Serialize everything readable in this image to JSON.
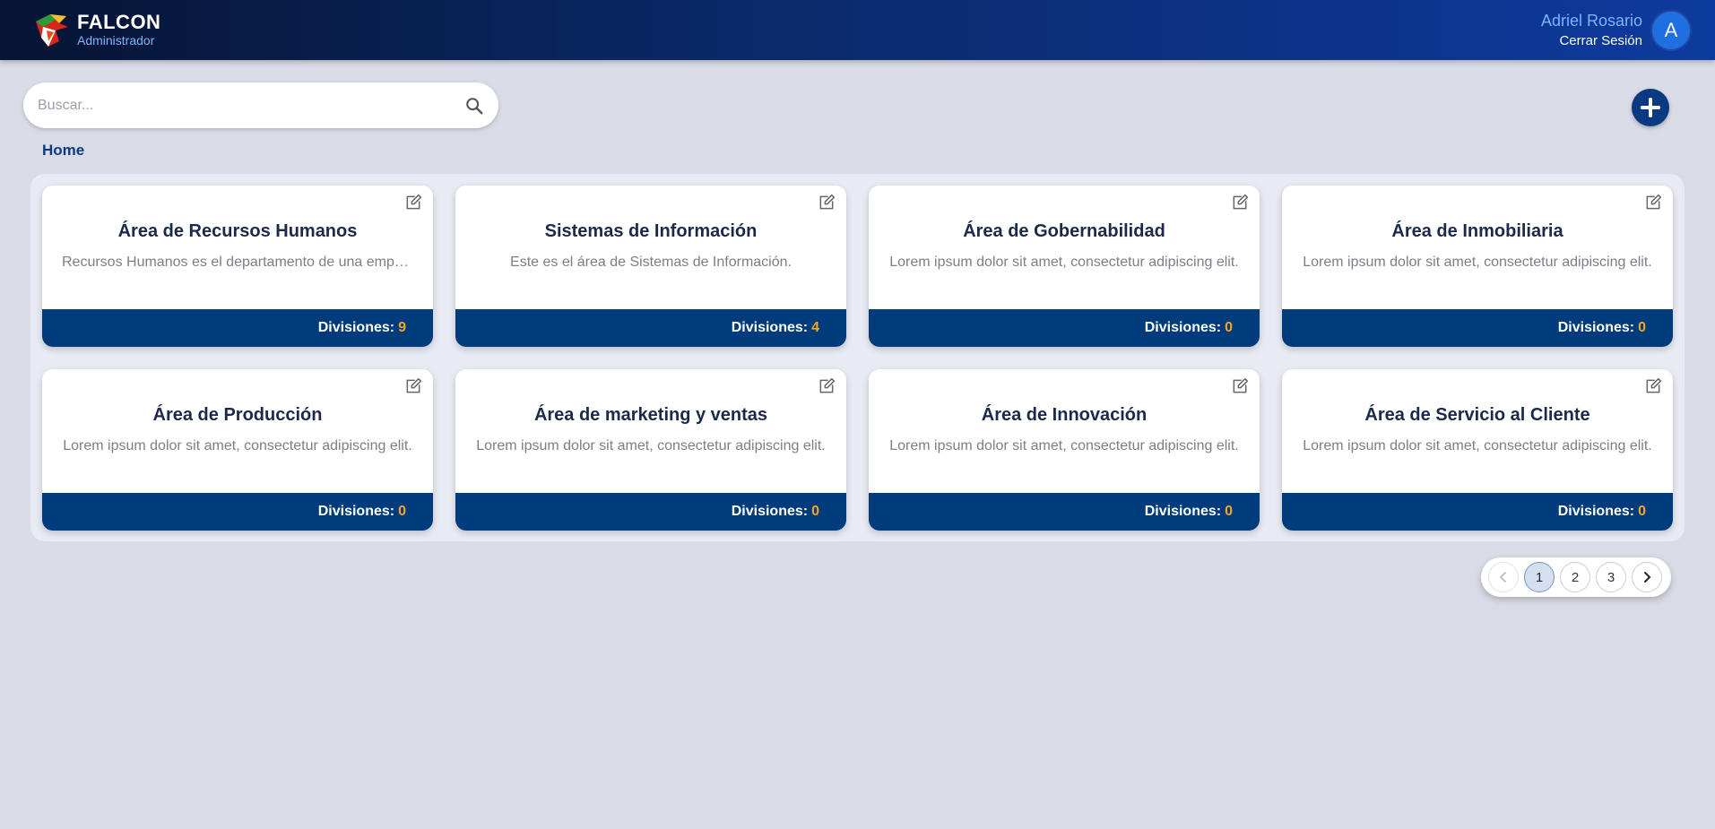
{
  "header": {
    "brand_name": "FALCON",
    "brand_role": "Administrador",
    "user_name": "Adriel Rosario",
    "logout_label": "Cerrar Sesión",
    "avatar_initial": "A"
  },
  "search": {
    "placeholder": "Buscar..."
  },
  "breadcrumb": {
    "home": "Home"
  },
  "cards": [
    {
      "title": "Área de Recursos Humanos",
      "description": "Recursos Humanos es el departamento de una empresa encargado de gestionar el talento humano.",
      "divisions_label": "Divisiones:",
      "divisions_count": "9"
    },
    {
      "title": "Sistemas de Información",
      "description": "Este es el área de Sistemas de Información.",
      "divisions_label": "Divisiones:",
      "divisions_count": "4"
    },
    {
      "title": "Área de Gobernabilidad",
      "description": "Lorem ipsum dolor sit amet, consectetur adipiscing elit.",
      "divisions_label": "Divisiones:",
      "divisions_count": "0"
    },
    {
      "title": "Área de Inmobiliaria",
      "description": "Lorem ipsum dolor sit amet, consectetur adipiscing elit.",
      "divisions_label": "Divisiones:",
      "divisions_count": "0"
    },
    {
      "title": "Área de Producción",
      "description": "Lorem ipsum dolor sit amet, consectetur adipiscing elit.",
      "divisions_label": "Divisiones:",
      "divisions_count": "0"
    },
    {
      "title": "Área de marketing y ventas",
      "description": "Lorem ipsum dolor sit amet, consectetur adipiscing elit.",
      "divisions_label": "Divisiones:",
      "divisions_count": "0"
    },
    {
      "title": "Área de Innovación",
      "description": "Lorem ipsum dolor sit amet, consectetur adipiscing elit.",
      "divisions_label": "Divisiones:",
      "divisions_count": "0"
    },
    {
      "title": "Área de Servicio al Cliente",
      "description": "Lorem ipsum dolor sit amet, consectetur adipiscing elit.",
      "divisions_label": "Divisiones:",
      "divisions_count": "0"
    }
  ],
  "pagination": {
    "pages": [
      "1",
      "2",
      "3"
    ],
    "current": "1"
  },
  "colors": {
    "header_start": "#061433",
    "header_end": "#0d3a9e",
    "primary": "#003b7c",
    "accent_count": "#f5a623",
    "user_name": "#7fb2ff"
  },
  "icons": {
    "logo": "falcon-logo",
    "search": "search-icon",
    "add": "plus-icon",
    "edit": "edit-icon",
    "prev": "chevron-left-icon",
    "next": "chevron-right-icon"
  }
}
